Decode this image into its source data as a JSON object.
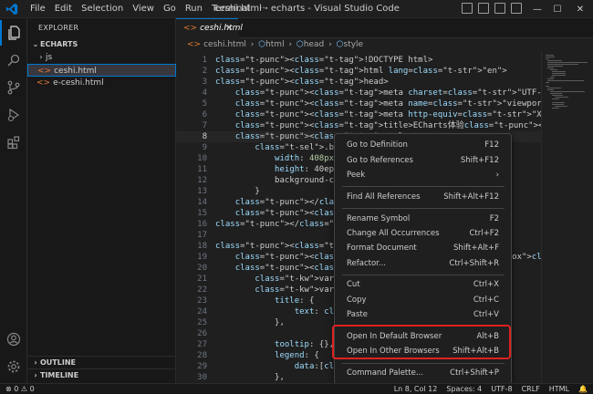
{
  "titlebar": {
    "menu": [
      "File",
      "Edit",
      "Selection",
      "View",
      "Go",
      "Run",
      "Terminal",
      "···"
    ],
    "title": "ceshi.html - echarts - Visual Studio Code",
    "controls": [
      "—",
      "☐",
      "✕"
    ]
  },
  "sidebar": {
    "title": "EXPLORER",
    "root": "ECHARTS",
    "items": [
      {
        "label": "js",
        "type": "folder"
      },
      {
        "label": "ceshi.html",
        "type": "file"
      },
      {
        "label": "e-ceshi.html",
        "type": "file"
      }
    ],
    "outline": "OUTLINE",
    "timeline": "TIMELINE"
  },
  "editor": {
    "tab": "ceshi.html",
    "breadcrumb": [
      "ceshi.html",
      "html",
      "head",
      "style"
    ],
    "lines": [
      {
        "n": "1",
        "text": "<!DOCTYPE html>"
      },
      {
        "n": "2",
        "text": "<html lang=\"en\">"
      },
      {
        "n": "3",
        "text": "<head>"
      },
      {
        "n": "4",
        "text": "    <meta charset=\"UTF-8\">"
      },
      {
        "n": "5",
        "text": "    <meta name=\"viewport\" content=\"width=device-width, initial-scale=1.0\""
      },
      {
        "n": "6",
        "text": "    <meta http-equiv=\"X-UA-Compatible\" content=\"ie=edge\">"
      },
      {
        "n": "7",
        "text": "    <title>ECharts体验</title>"
      },
      {
        "n": "8",
        "text": "    <style>"
      },
      {
        "n": "9",
        "text": "        .box {"
      },
      {
        "n": "10",
        "text": "            width: 408px;"
      },
      {
        "n": "11",
        "text": "            height: 40epx"
      },
      {
        "n": "12",
        "text": "            background-co"
      },
      {
        "n": "13",
        "text": "        }"
      },
      {
        "n": "14",
        "text": "    </style>"
      },
      {
        "n": "15",
        "text": "    <script src=\"js/echar                                      -->"
      },
      {
        "n": "16",
        "text": "</head>"
      },
      {
        "n": "17",
        "text": ""
      },
      {
        "n": "18",
        "text": "<body>"
      },
      {
        "n": "19",
        "text": "    <div class=\"box\"></di"
      },
      {
        "n": "20",
        "text": "    <script>"
      },
      {
        "n": "21",
        "text": "        var mychart = echa                                    s"
      },
      {
        "n": "22",
        "text": "        var option = {"
      },
      {
        "n": "23",
        "text": "            title: {"
      },
      {
        "n": "24",
        "text": "                text: 'EC"
      },
      {
        "n": "25",
        "text": "            },"
      },
      {
        "n": "26",
        "text": ""
      },
      {
        "n": "27",
        "text": "            tooltip: {},"
      },
      {
        "n": "28",
        "text": "            legend: {"
      },
      {
        "n": "29",
        "text": "                data:['销"
      },
      {
        "n": "30",
        "text": "            },"
      }
    ]
  },
  "context_menu": {
    "items": [
      {
        "label": "Go to Definition",
        "kb": "F12"
      },
      {
        "label": "Go to References",
        "kb": "Shift+F12"
      },
      {
        "label": "Peek",
        "kb": "›"
      },
      {
        "label": "Find All References",
        "kb": "Shift+Alt+F12"
      },
      {
        "label": "Rename Symbol",
        "kb": "F2"
      },
      {
        "label": "Change All Occurrences",
        "kb": "Ctrl+F2"
      },
      {
        "label": "Format Document",
        "kb": "Shift+Alt+F"
      },
      {
        "label": "Refactor...",
        "kb": "Ctrl+Shift+R"
      },
      {
        "label": "Cut",
        "kb": "Ctrl+X"
      },
      {
        "label": "Copy",
        "kb": "Ctrl+C"
      },
      {
        "label": "Paste",
        "kb": "Ctrl+V"
      },
      {
        "label": "Open In Default Browser",
        "kb": "Alt+B"
      },
      {
        "label": "Open In Other Browsers",
        "kb": "Shift+Alt+B"
      },
      {
        "label": "Command Palette...",
        "kb": "Ctrl+Shift+P"
      }
    ]
  },
  "statusbar": {
    "left": "⊗ 0 ⚠ 0",
    "right": [
      "Ln 8, Col 12",
      "Spaces: 4",
      "UTF-8",
      "CRLF",
      "HTML",
      "🔔"
    ]
  },
  "colors": {
    "accent": "#0078d4",
    "highlight": "#e02020"
  }
}
